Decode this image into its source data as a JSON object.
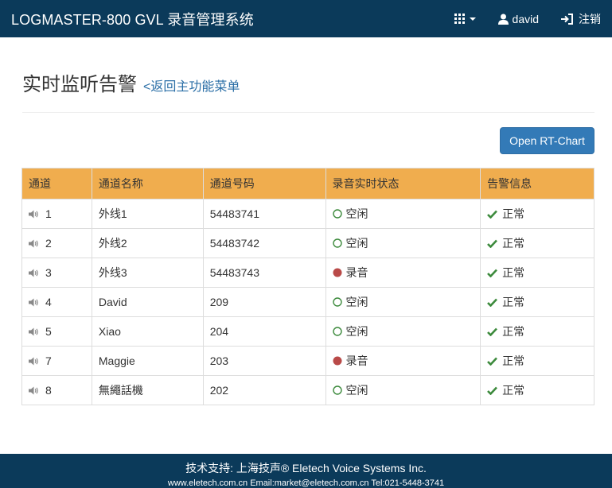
{
  "navbar": {
    "brand": "LOGMASTER-800 GVL 录音管理系统",
    "user": "david",
    "logout": "注销"
  },
  "header": {
    "title": "实时监听告警",
    "back_link": "<返回主功能菜单"
  },
  "toolbar": {
    "rt_chart_button": "Open RT-Chart"
  },
  "table": {
    "columns": [
      "通道",
      "通道名称",
      "通道号码",
      "录音实时状态",
      "告警信息"
    ],
    "rows": [
      {
        "channel": "1",
        "name": "外线1",
        "number": "54483741",
        "status": "空闲",
        "status_type": "idle",
        "alarm": "正常"
      },
      {
        "channel": "2",
        "name": "外线2",
        "number": "54483742",
        "status": "空闲",
        "status_type": "idle",
        "alarm": "正常"
      },
      {
        "channel": "3",
        "name": "外线3",
        "number": "54483743",
        "status": "录音",
        "status_type": "recording",
        "alarm": "正常"
      },
      {
        "channel": "4",
        "name": "David",
        "number": "209",
        "status": "空闲",
        "status_type": "idle",
        "alarm": "正常"
      },
      {
        "channel": "5",
        "name": "Xiao",
        "number": "204",
        "status": "空闲",
        "status_type": "idle",
        "alarm": "正常"
      },
      {
        "channel": "7",
        "name": "Maggie",
        "number": "203",
        "status": "录音",
        "status_type": "recording",
        "alarm": "正常"
      },
      {
        "channel": "8",
        "name": "無繩話機",
        "number": "202",
        "status": "空闲",
        "status_type": "idle",
        "alarm": "正常"
      }
    ]
  },
  "footer": {
    "line1": "技术支持: 上海技声® Eletech Voice Systems Inc.",
    "line2": "www.eletech.com.cn Email:market@eletech.com.cn Tel:021-5448-3741"
  },
  "icons": {
    "apps": "grid-icon",
    "user": "user-icon",
    "logout": "logout-icon",
    "speaker": "speaker-icon",
    "idle": "circle-outline-icon",
    "recording": "filled-circle-icon",
    "ok": "check-icon"
  },
  "colors": {
    "navbar": "#0b3a5a",
    "table_header": "#f0ad4e",
    "primary_button": "#337ab7",
    "link": "#2a6ea6",
    "idle": "#3c8a3c",
    "recording": "#b94a48",
    "check": "#3c8a3c"
  }
}
